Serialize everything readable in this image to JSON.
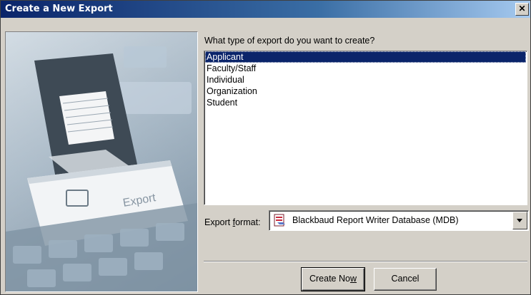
{
  "window": {
    "title": "Create a New Export",
    "close_label": "✕"
  },
  "art": {
    "key_label": "Export"
  },
  "prompt": "What type of export do you want to create?",
  "types": [
    {
      "label": "Applicant",
      "selected": true
    },
    {
      "label": "Faculty/Staff",
      "selected": false
    },
    {
      "label": "Individual",
      "selected": false
    },
    {
      "label": "Organization",
      "selected": false
    },
    {
      "label": "Student",
      "selected": false
    }
  ],
  "format": {
    "label_before": "Export ",
    "label_accel": "f",
    "label_after": "ormat:",
    "value": "Blackbaud Report Writer Database (MDB)",
    "icon": "database-report-icon"
  },
  "buttons": {
    "create_before": "Create No",
    "create_accel": "w",
    "cancel": "Cancel"
  }
}
